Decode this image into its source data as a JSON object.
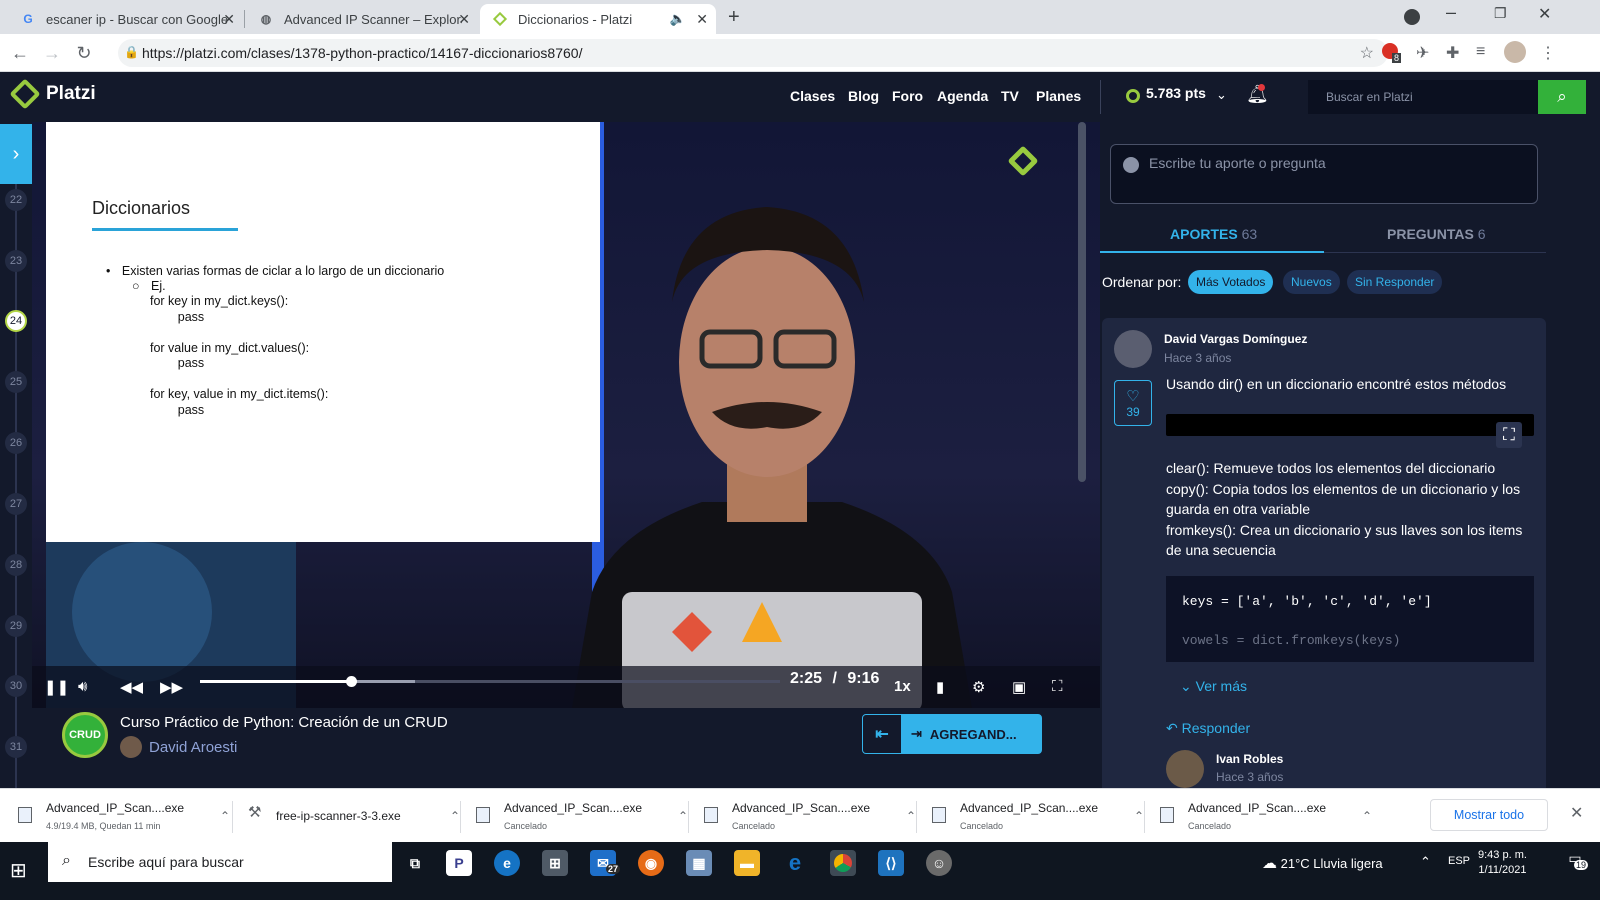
{
  "browser": {
    "tabs": [
      {
        "title": "escaner ip - Buscar con Google",
        "icon": "G"
      },
      {
        "title": "Advanced IP Scanner – Explorado",
        "icon": "globe"
      },
      {
        "title": "Diccionarios - Platzi",
        "icon": "platzi"
      }
    ],
    "url": "https://platzi.com/clases/1378-python-practico/14167-diccionarios8760/",
    "ext_badge": "8"
  },
  "platzi": {
    "logo_text": "Platzi",
    "nav": [
      "Clases",
      "Blog",
      "Foro",
      "Agenda",
      "TV",
      "Planes"
    ],
    "points": "5.783 pts",
    "search_placeholder": "Buscar en Platzi"
  },
  "rail": {
    "lessons": [
      "22",
      "23",
      "24",
      "25",
      "26",
      "27",
      "28",
      "29",
      "30",
      "31"
    ],
    "current": "24"
  },
  "slide": {
    "title": "Diccionarios",
    "bullet": "Existen varias formas de ciclar a lo largo de un diccionario",
    "sub": "Ej.",
    "code": "for key in my_dict.keys():\n        pass\n\nfor value in my_dict.values():\n        pass\n\nfor key, value in my_dict.items():\n        pass"
  },
  "player": {
    "current_time": "2:25",
    "separator": "/",
    "duration": "9:16",
    "speed": "1x",
    "progress_fraction": 0.26,
    "buffered_fraction": 0.37
  },
  "course": {
    "badge": "CRUD",
    "title": "Curso Práctico de Python: Creación de un CRUD",
    "teacher": "David Aroesti",
    "next_label": "AGREGAND..."
  },
  "discussion": {
    "ask_placeholder": "Escribe tu aporte o pregunta",
    "tab_aportes": "APORTES",
    "tab_aportes_count": "63",
    "tab_preguntas": "PREGUNTAS",
    "tab_preguntas_count": "6",
    "sort_label": "Ordenar por:",
    "sort_options": [
      "Más Votados",
      "Nuevos",
      "Sin Responder"
    ],
    "post": {
      "author": "David Vargas Domínguez",
      "ago": "Hace 3 años",
      "likes": "39",
      "intro": "Usando dir() en un diccionario encontré estos métodos",
      "desc": [
        "clear(): Remueve todos los elementos del diccionario",
        "copy(): Copia todos los elementos de un diccionario y los guarda en otra variable",
        "fromkeys(): Crea un diccionario y sus llaves son los items de una secuencia"
      ],
      "code_line1": "keys = ['a', 'b', 'c', 'd', 'e']",
      "code_line2": "vowels = dict.fromkeys(keys)",
      "ver_mas": "Ver más",
      "responder": "Responder"
    },
    "reply": {
      "author": "Ivan Robles",
      "ago": "Hace 3 años"
    }
  },
  "downloads": {
    "items": [
      {
        "name": "Advanced_IP_Scan....exe",
        "sub": "4.9/19.4 MB, Quedan 11 min"
      },
      {
        "name": "free-ip-scanner-3-3.exe",
        "sub": ""
      },
      {
        "name": "Advanced_IP_Scan....exe",
        "sub": "Cancelado"
      },
      {
        "name": "Advanced_IP_Scan....exe",
        "sub": "Cancelado"
      },
      {
        "name": "Advanced_IP_Scan....exe",
        "sub": "Cancelado"
      },
      {
        "name": "Advanced_IP_Scan....exe",
        "sub": "Cancelado"
      }
    ],
    "show_all": "Mostrar todo"
  },
  "taskbar": {
    "search_placeholder": "Escribe aquí para buscar",
    "mail_badge": "27",
    "weather": "21°C  Lluvia ligera",
    "lang": "ESP",
    "time": "9:43 p. m.",
    "date": "1/11/2021",
    "notif_count": "19"
  },
  "colors": {
    "platzi_bg": "#13192b",
    "platzi_green": "#98ca3f",
    "accent_blue": "#33b3ea",
    "search_green": "#33b13a"
  }
}
